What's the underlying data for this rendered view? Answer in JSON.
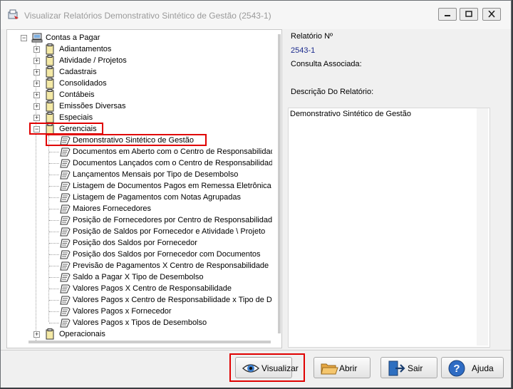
{
  "window": {
    "title": "Visualizar Relatórios Demonstrativo Sintético de Gestão (2543-1)"
  },
  "tree": {
    "root": {
      "label": "Contas a Pagar",
      "expander": "−"
    },
    "groups": [
      {
        "label": "Adiantamentos",
        "expander": "+"
      },
      {
        "label": "Atividade / Projetos",
        "expander": "+"
      },
      {
        "label": "Cadastrais",
        "expander": "+"
      },
      {
        "label": "Consolidados",
        "expander": "+"
      },
      {
        "label": "Contábeis",
        "expander": "+"
      },
      {
        "label": "Emissões Diversas",
        "expander": "+"
      },
      {
        "label": "Especiais",
        "expander": "+"
      },
      {
        "label": "Gerenciais",
        "expander": "−"
      }
    ],
    "reports": [
      {
        "label": "Demonstrativo Sintético de Gestão"
      },
      {
        "label": "Documentos em Aberto com o Centro de Responsabilidade"
      },
      {
        "label": "Documentos Lançados com o Centro de Responsabilidade"
      },
      {
        "label": "Lançamentos Mensais por Tipo de Desembolso"
      },
      {
        "label": "Listagem de Documentos Pagos em Remessa Eletrônica"
      },
      {
        "label": "Listagem de Pagamentos com Notas Agrupadas"
      },
      {
        "label": "Maiores Fornecedores"
      },
      {
        "label": "Posição de Fornecedores por Centro de Responsabilidade"
      },
      {
        "label": "Posição de Saldos por Fornecedor e Atividade \\ Projeto"
      },
      {
        "label": "Posição dos Saldos por Fornecedor"
      },
      {
        "label": "Posição dos Saldos por Fornecedor com Documentos"
      },
      {
        "label": "Previsão de Pagamentos X Centro de Responsabilidade"
      },
      {
        "label": "Saldo a Pagar X Tipo de Desembolso"
      },
      {
        "label": "Valores Pagos X Centro de Responsabilidade"
      },
      {
        "label": "Valores Pagos x Centro de Responsabilidade x Tipo de Desembolso"
      },
      {
        "label": "Valores Pagos x Fornecedor"
      },
      {
        "label": "Valores Pagos x Tipos de Desembolso"
      }
    ],
    "after": {
      "label": "Operacionais",
      "expander": "+"
    }
  },
  "details": {
    "report_number_label": "Relatório Nº",
    "report_number": "2543-1",
    "query_label": "Consulta Associada:",
    "description_label": "Descrição Do Relatório:",
    "description": "Demonstrativo Sintético de Gestão"
  },
  "buttons": {
    "visualizar": "Visualizar",
    "abrir": "Abrir",
    "sair": "Sair",
    "ajuda": "Ajuda"
  },
  "colors": {
    "highlight": "#e00000",
    "report_number": "#1a2a8c"
  }
}
